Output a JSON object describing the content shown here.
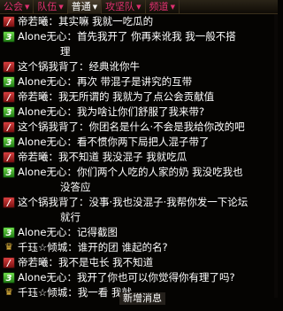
{
  "tabs": [
    {
      "label": "公会",
      "active": false
    },
    {
      "label": "队伍",
      "active": false
    },
    {
      "label": "普通",
      "active": true
    },
    {
      "label": "攻坚队",
      "active": false
    },
    {
      "label": "频道",
      "active": false
    }
  ],
  "messages": [
    {
      "badge": "red",
      "badge_text": "/",
      "text": "帝若曦：其实嘛 我就一吃瓜的",
      "cont": ""
    },
    {
      "badge": "green",
      "badge_text": "3",
      "text": "Alone无心：首先我开了  你再来讹我   我一般不搭",
      "cont": "理"
    },
    {
      "badge": "red",
      "badge_text": "/",
      "text": "这个锅我背了：经典讹你牛",
      "cont": ""
    },
    {
      "badge": "green",
      "badge_text": "3",
      "text": "Alone无心：再次 带混子是讲究的互带",
      "cont": ""
    },
    {
      "badge": "red",
      "badge_text": "/",
      "text": "帝若曦：我无所谓的 我就为了点公会贡献值",
      "cont": ""
    },
    {
      "badge": "green",
      "badge_text": "3",
      "text": "Alone无心：我为啥让你们舒服了我来带?",
      "cont": ""
    },
    {
      "badge": "red",
      "badge_text": "/",
      "text": "这个锅我背了：你团名是什么·不会是我给你改的吧",
      "cont": ""
    },
    {
      "badge": "green",
      "badge_text": "3",
      "text": "Alone无心：看不惯你两下局把人混子带了",
      "cont": ""
    },
    {
      "badge": "red",
      "badge_text": "/",
      "text": "帝若曦：我不知道 我没混子 我就吃瓜",
      "cont": ""
    },
    {
      "badge": "green",
      "badge_text": "3",
      "text": "Alone无心：你们两个人吃的人家的奶 我没吃我也",
      "cont": "没答应"
    },
    {
      "badge": "red",
      "badge_text": "/",
      "text": "这个锅我背了：没事·我也没混子·我帮你发一下论坛",
      "cont": "就行"
    },
    {
      "badge": "green",
      "badge_text": "3",
      "text": "Alone无心：记得截图",
      "cont": ""
    },
    {
      "badge": "crown",
      "badge_text": "♛",
      "text": "千珏☆倾城：谁开的团 谁起的名?",
      "cont": ""
    },
    {
      "badge": "red",
      "badge_text": "/",
      "text": "帝若曦：我不是屯长 我不知道",
      "cont": ""
    },
    {
      "badge": "green",
      "badge_text": "3",
      "text": "Alone无心：我开了你也可以你觉得你有理了吗?",
      "cont": ""
    },
    {
      "badge": "crown",
      "badge_text": "♛",
      "text": "千珏☆倾城：我一看  我就",
      "cont": ""
    }
  ],
  "new_message_label": "新增消息"
}
